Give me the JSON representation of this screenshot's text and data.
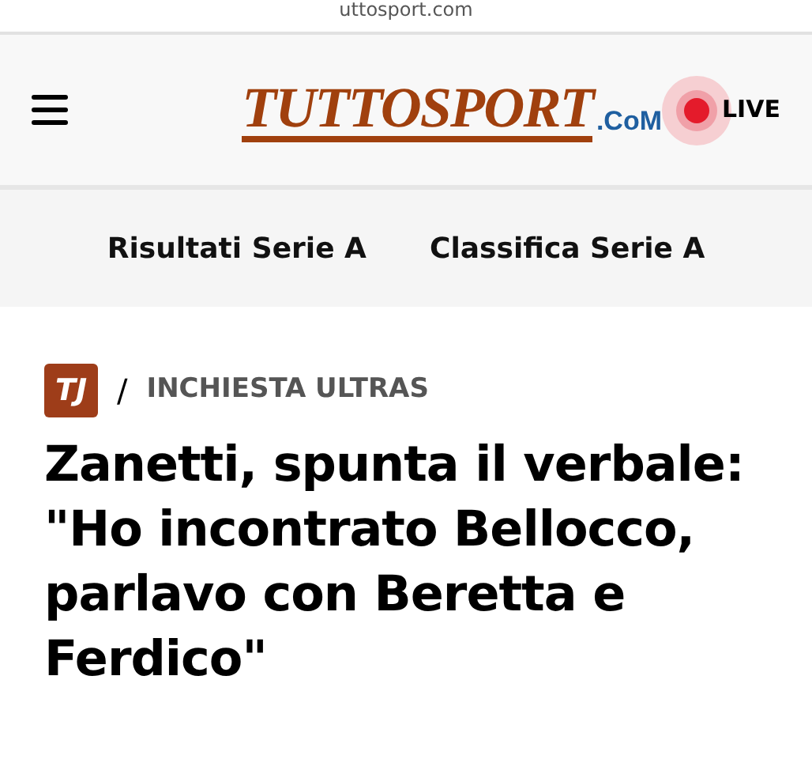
{
  "address_bar": {
    "url": "uttosport.com"
  },
  "header": {
    "logo": {
      "text": "TUTTOSPORT",
      "suffix": ".CoM"
    },
    "live": {
      "label": "LIVE"
    }
  },
  "nav": {
    "links": [
      {
        "label": "Risultati Serie A"
      },
      {
        "label": "Classifica Serie A"
      }
    ]
  },
  "article": {
    "section_badge": "TJ",
    "breadcrumb": "INCHIESTA ULTRAS",
    "separator": "/",
    "headline": "Zanetti, spunta il verbale: \"Ho incontrato Bellocco, parlavo con Beretta e Ferdico\""
  }
}
